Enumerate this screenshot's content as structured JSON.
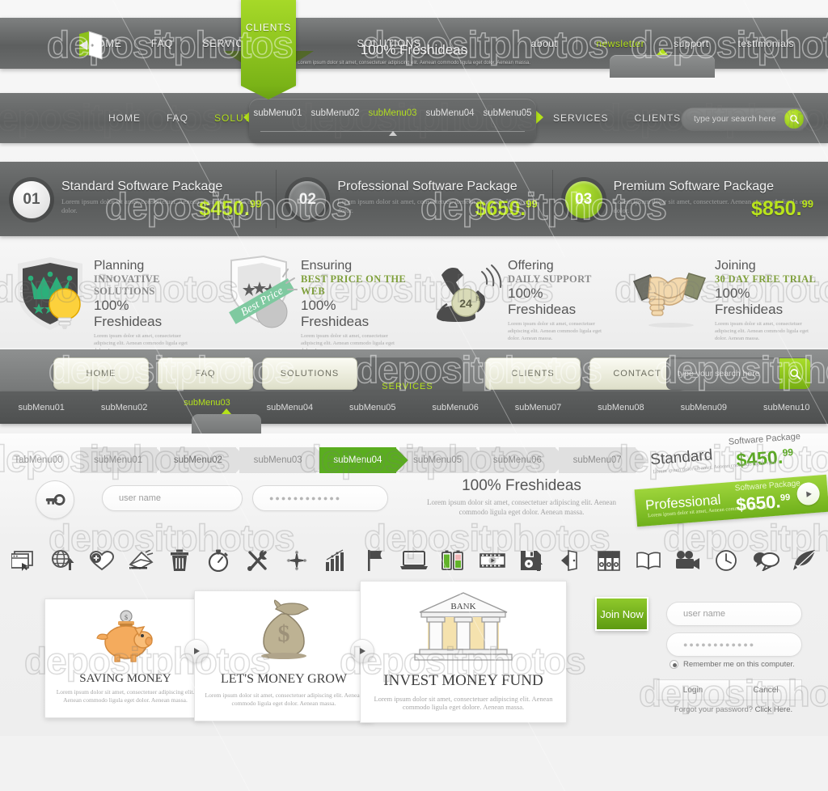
{
  "nav1": {
    "logo_icon": "open-door-logo-icon",
    "items": [
      "HOME",
      "FAQ",
      "SERVICES"
    ],
    "highlight_item": "CLIENTS",
    "items_after": [
      "SOLUTIONS"
    ],
    "brand": "100% Freshideas",
    "brand_sub": "Lorem ipsum dolor sit amet, consectetuer adipiscing elit.\nAenean commodo ligula eget dolor. Aenean massa.",
    "right_items": [
      "about",
      "newsletter",
      "support",
      "testimonials"
    ],
    "right_active": "newsletter",
    "separator": "|"
  },
  "nav2": {
    "left_items": [
      "HOME",
      "FAQ",
      "SOLUTIONS"
    ],
    "active_left": "SOLUTIONS",
    "submenu": [
      "subMenu01",
      "subMenu02",
      "subMenu03",
      "subMenu04",
      "subMenu05"
    ],
    "submenu_active": "subMenu03",
    "right_items": [
      "SERVICES",
      "CLIENTS"
    ],
    "search_placeholder": "type your search here",
    "search_icon": "magnifier-icon"
  },
  "pricing": {
    "packages": [
      {
        "num": "01",
        "title": "Standard Software Package",
        "desc": "Lorem ipsum dolor sit amet, consectetuer. Aenean commodo ligula eget dolor.",
        "price": "$450.",
        "cents": "99"
      },
      {
        "num": "02",
        "title": "Professional Software Package",
        "desc": "Lorem ipsum dolor sit amet, consectetuer. Aenean commodo ligula eget dolor.",
        "price": "$650.",
        "cents": "99"
      },
      {
        "num": "03",
        "title": "Premium Software Package",
        "desc": "Lorem ipsum dolor sit amet, consectetuer. Aenean commodo ligula eget dolor.",
        "price": "$850.",
        "cents": "99"
      }
    ],
    "price_color": "#b9e41c"
  },
  "features": [
    {
      "icon": "shield-crown-bulb-icon",
      "title": "Planning",
      "subtitle": "INNOVATIVE SOLUTIONS",
      "big": "100% Freshideas",
      "lorem": "Lorem ipsum dolor sit amet, consectetuer adipiscing elit.\nAenean commodo ligula eget dolor. Aenean massa.",
      "sub_green": false
    },
    {
      "icon": "best-price-badge-icon",
      "title": "Ensuring",
      "subtitle": "BEST PRICE ON THE WEB",
      "big": "100% Freshideas",
      "lorem": "Lorem ipsum dolor sit amet, consectetuer adipiscing elit.\nAenean commodo ligula eget dolor. Aenean massa.",
      "sub_green": true
    },
    {
      "icon": "telephone-24h-icon",
      "title": "Offering",
      "subtitle": "DAILY SUPPORT",
      "big": "100% Freshideas",
      "lorem": "Lorem ipsum dolor sit amet, consectetuer adipiscing elit.\nAenean commodo ligula eget dolor. Aenean massa.",
      "sub_green": false
    },
    {
      "icon": "handshake-icon",
      "title": "Joining",
      "subtitle": "30 DAY FREE TRIAL",
      "big": "100% Freshideas",
      "lorem": "Lorem ipsum dolor sit amet, consectetuer adipiscing elit.\nAenean commodo ligula eget dolor. Aenean massa.",
      "sub_green": true
    }
  ],
  "nav3": {
    "buttons": [
      "HOME",
      "FAQ",
      "SOLUTIONS",
      "CLIENTS",
      "CONTACT"
    ],
    "active_tab": "SERVICES",
    "search_placeholder": "type your search here",
    "search_icon": "magnifier-icon",
    "submenus": [
      "subMenu01",
      "subMenu02",
      "subMenu03",
      "subMenu04",
      "subMenu05",
      "subMenu06",
      "subMenu07",
      "subMenu08",
      "subMenu09",
      "subMenu10"
    ],
    "submenu_active": "subMenu03"
  },
  "tabmenu": {
    "first": "TabMenu00",
    "tabs": [
      "subMenu01",
      "subMenu02",
      "subMenu03",
      "subMenu04",
      "subMenu05",
      "subMenu06",
      "subMenu07"
    ],
    "active": "subMenu04",
    "emphasis": "subMenu02",
    "active_color": "#5aad1f"
  },
  "tabform": {
    "key_icon": "key-icon",
    "username_placeholder": "user name",
    "password_value": "●●●●●●●●●●●●",
    "headline": "100% Freshideas",
    "lorem": "Lorem ipsum dolor sit amet, consectetuer adipiscing elit.\nAenean commodo ligula eget dolor. Aenean massa."
  },
  "ribbons": {
    "standard": {
      "name": "Standard",
      "sub": "Software Package",
      "price": "$450.",
      "cents": "99",
      "lorem": "Lorem ipsum dolor sit amet,\nAenean commodo ligula eget."
    },
    "professional": {
      "name": "Professional",
      "sub": "Software Package",
      "price": "$650.",
      "cents": "99",
      "lorem": "Lorem ipsum dolor sit amet,\nAenean commodo ligula eget.",
      "play_icon": "play-icon",
      "color": "#7ebd22"
    }
  },
  "icons": [
    "browser-window-cursor-icon",
    "globe-upload-icon",
    "heart-plus-icon",
    "envelope-send-icon",
    "trash-bin-icon",
    "stopwatch-icon",
    "wrench-screwdriver-icon",
    "compass-star-icon",
    "bar-chart-icon",
    "flag-icon",
    "laptop-icon",
    "battery-icon",
    "film-play-icon",
    "floppy-save-icon",
    "exit-door-icon",
    "binders-icon",
    "open-book-icon",
    "movie-camera-icon",
    "clock-icon",
    "speech-bubbles-icon",
    "feather-quill-icon"
  ],
  "cards": [
    {
      "art": "piggy-bank-icon",
      "title": "SAVING MONEY",
      "lorem": "Lorem ipsum dolor sit amet, consectetuer adipiscing elit.\nAenean commodo ligula eget dolor. Aenean massa."
    },
    {
      "art": "money-bag-icon",
      "title": "LET'S MONEY GROW",
      "lorem": "Lorem ipsum dolor sit amet, consectetuer adipiscing elit.\nAenean commodo ligula eget dolor. Aenean massa."
    },
    {
      "art": "bank-building-icon",
      "title": "INVEST MONEY FUND",
      "lorem": "Lorem ipsum dolor sit amet, consectetuer adipiscing elit.\nAenean commodo ligula eget dolore. Aenean massa.",
      "building_label": "BANK"
    }
  ],
  "loginpanel": {
    "join_label": "Join Now",
    "username_placeholder": "user name",
    "password_value": "●●●●●●●●●●●●",
    "remember_label": "Remember me on this computer.",
    "login_label": "Login",
    "cancel_label": "Cancel",
    "forgot_text": "Forgot your password? ",
    "forgot_link": "Click Here."
  },
  "watermark": {
    "text": "depositphotos"
  }
}
